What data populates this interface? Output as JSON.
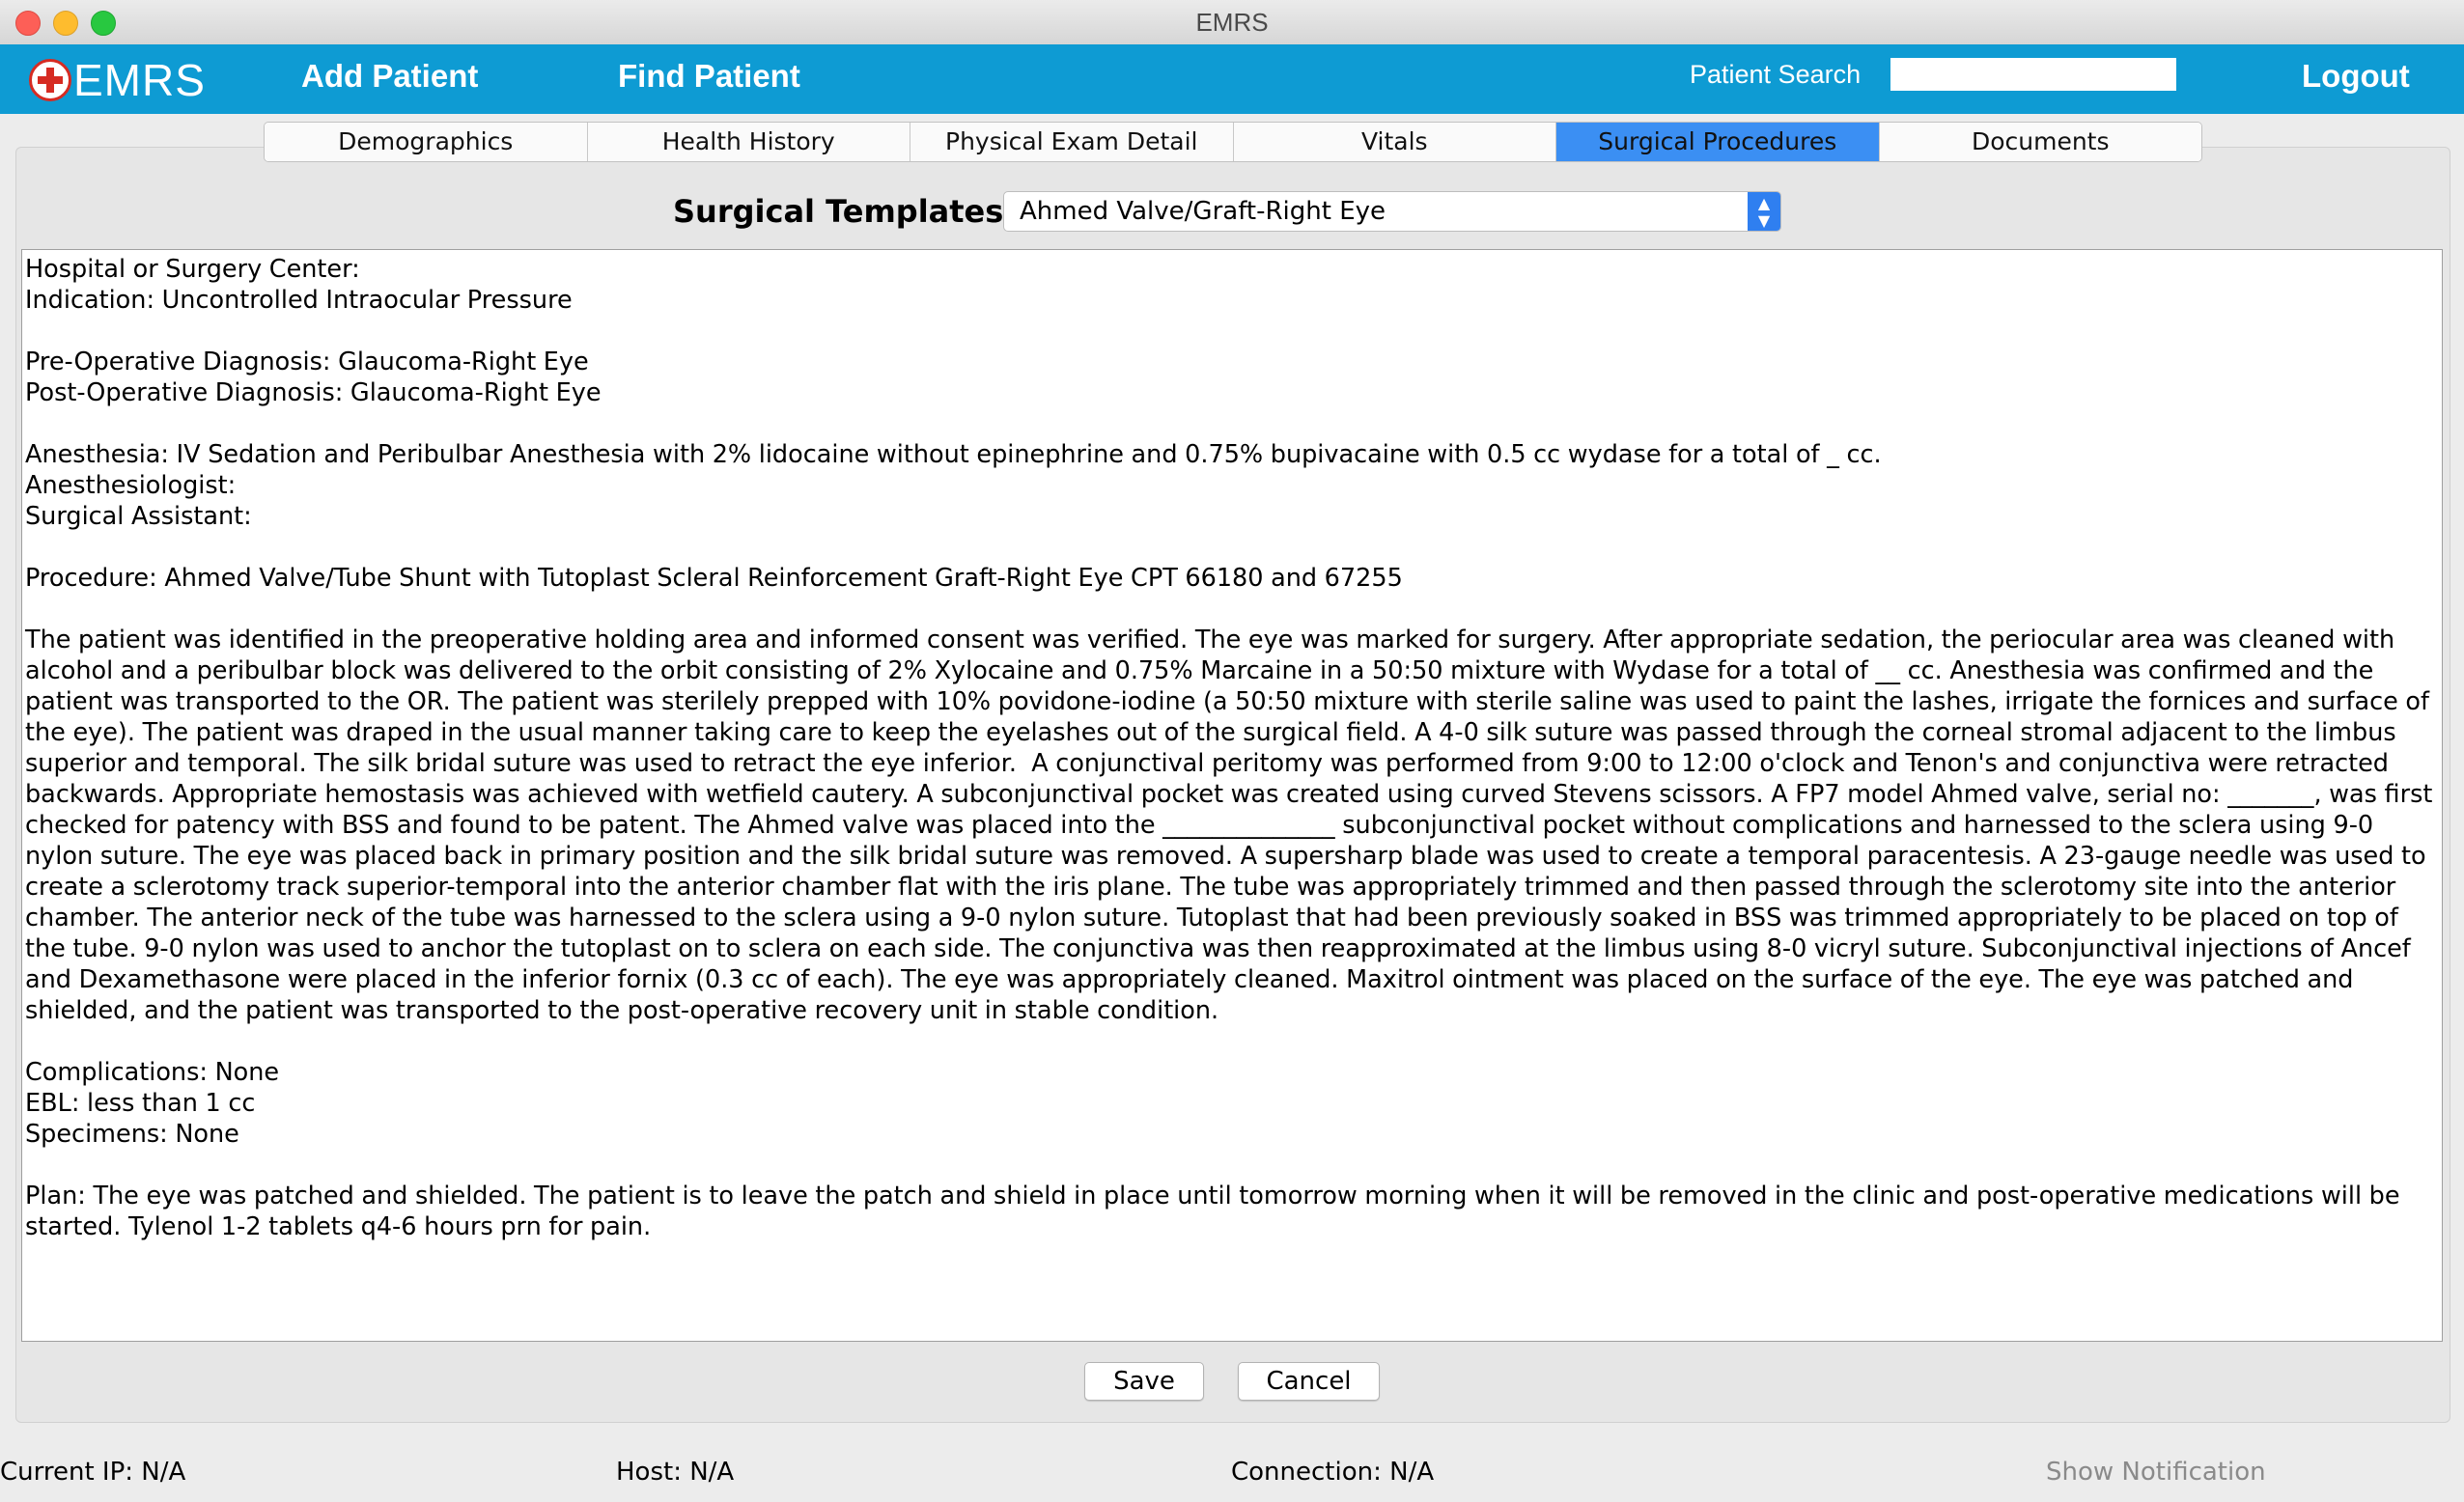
{
  "window": {
    "title": "EMRS"
  },
  "header": {
    "logo_text": "EMRS",
    "add_patient": "Add Patient",
    "find_patient": "Find Patient",
    "search_label": "Patient Search",
    "search_value": "",
    "logout": "Logout"
  },
  "tabs": [
    {
      "label": "Demographics",
      "active": false
    },
    {
      "label": "Health History",
      "active": false
    },
    {
      "label": "Physical Exam Detail",
      "active": false
    },
    {
      "label": "Vitals",
      "active": false
    },
    {
      "label": "Surgical Procedures",
      "active": true
    },
    {
      "label": "Documents",
      "active": false
    }
  ],
  "template": {
    "label": "Surgical Templates:",
    "selected": "Ahmed Valve/Graft-Right Eye"
  },
  "notes_text": "Hospital or Surgery Center:\nIndication: Uncontrolled Intraocular Pressure\n\nPre-Operative Diagnosis: Glaucoma-Right Eye\nPost-Operative Diagnosis: Glaucoma-Right Eye\n\nAnesthesia: IV Sedation and Peribulbar Anesthesia with 2% lidocaine without epinephrine and 0.75% bupivacaine with 0.5 cc wydase for a total of _ cc.\nAnesthesiologist:\nSurgical Assistant:\n\nProcedure: Ahmed Valve/Tube Shunt with Tutoplast Scleral Reinforcement Graft-Right Eye CPT 66180 and 67255\n\nThe patient was identified in the preoperative holding area and informed consent was verified. The eye was marked for surgery. After appropriate sedation, the periocular area was cleaned with alcohol and a peribulbar block was delivered to the orbit consisting of 2% Xylocaine and 0.75% Marcaine in a 50:50 mixture with Wydase for a total of __ cc. Anesthesia was confirmed and the patient was transported to the OR. The patient was sterilely prepped with 10% povidone-iodine (a 50:50 mixture with sterile saline was used to paint the lashes, irrigate the fornices and surface of the eye). The patient was draped in the usual manner taking care to keep the eyelashes out of the surgical field. A 4-0 silk suture was passed through the corneal stromal adjacent to the limbus superior and temporal. The silk bridal suture was used to retract the eye inferior.  A conjunctival peritomy was performed from 9:00 to 12:00 o'clock and Tenon's and conjunctiva were retracted backwards. Appropriate hemostasis was achieved with wetfield cautery. A subconjunctival pocket was created using curved Stevens scissors. A FP7 model Ahmed valve, serial no: _______, was first checked for patency with BSS and found to be patent. The Ahmed valve was placed into the ______________ subconjunctival pocket without complications and harnessed to the sclera using 9-0 nylon suture. The eye was placed back in primary position and the silk bridal suture was removed. A supersharp blade was used to create a temporal paracentesis. A 23-gauge needle was used to create a sclerotomy track superior-temporal into the anterior chamber flat with the iris plane. The tube was appropriately trimmed and then passed through the sclerotomy site into the anterior chamber. The anterior neck of the tube was harnessed to the sclera using a 9-0 nylon suture. Tutoplast that had been previously soaked in BSS was trimmed appropriately to be placed on top of the tube. 9-0 nylon was used to anchor the tutoplast on to sclera on each side. The conjunctiva was then reapproximated at the limbus using 8-0 vicryl suture. Subconjunctival injections of Ancef and Dexamethasone were placed in the inferior fornix (0.3 cc of each). The eye was appropriately cleaned. Maxitrol ointment was placed on the surface of the eye. The eye was patched and shielded, and the patient was transported to the post-operative recovery unit in stable condition.\n\nComplications: None\nEBL: less than 1 cc\nSpecimens: None\n\nPlan: The eye was patched and shielded. The patient is to leave the patch and shield in place until tomorrow morning when it will be removed in the clinic and post-operative medications will be started. Tylenol 1-2 tablets q4-6 hours prn for pain.",
  "buttons": {
    "save": "Save",
    "cancel": "Cancel"
  },
  "status": {
    "current_ip": "Current IP: N/A",
    "host": "Host: N/A",
    "connection": "Connection: N/A",
    "notification": "Show Notification"
  },
  "colors": {
    "header_bg": "#0e9bd3",
    "active_tab": "#3b8ff3",
    "logo_red": "#d62b22"
  }
}
